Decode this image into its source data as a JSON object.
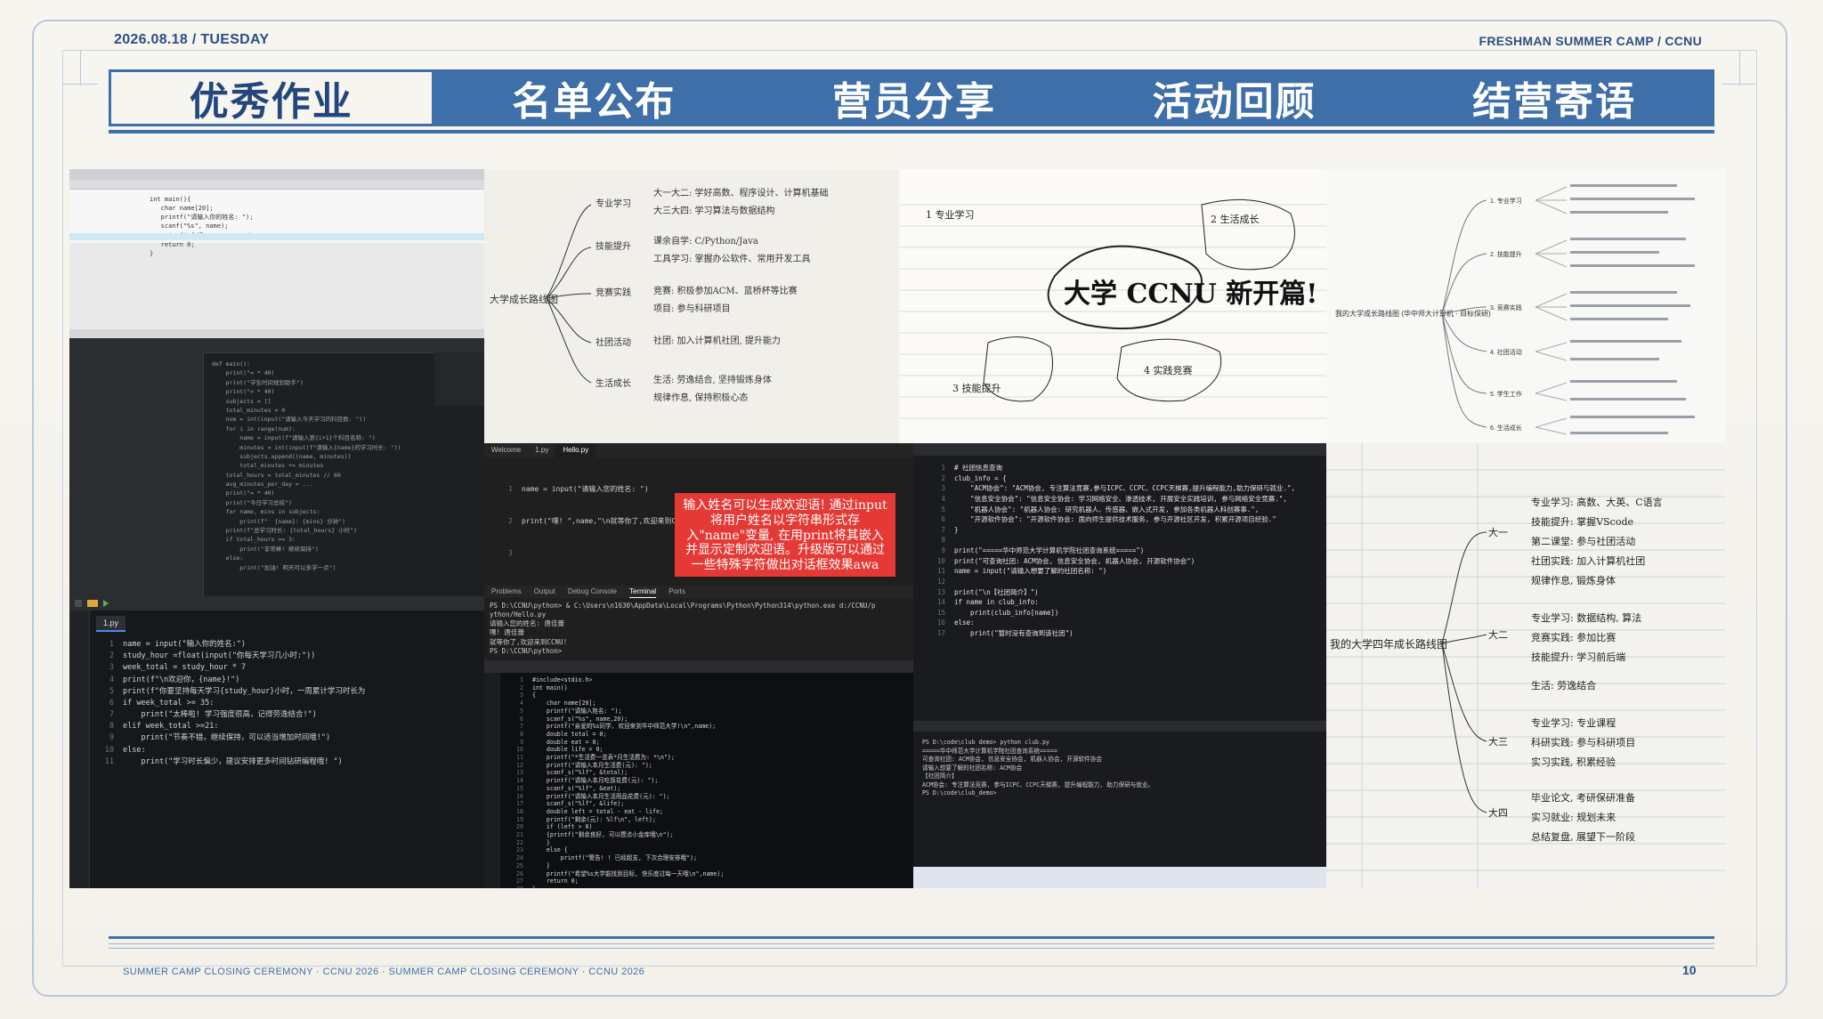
{
  "header": {
    "date": "2026.08.18 / TUESDAY",
    "org": "FRESHMAN SUMMER CAMP / CCNU"
  },
  "tabs": [
    {
      "label": "优秀作业",
      "active": true
    },
    {
      "label": "名单公布",
      "active": false
    },
    {
      "label": "营员分享",
      "active": false
    },
    {
      "label": "活动回顾",
      "active": false
    },
    {
      "label": "结营寄语",
      "active": false
    }
  ],
  "gallery": {
    "ide_python_code": [
      "name = input(\"输入你的姓名:\")",
      "study_hour =float(input(\"你每天学习几小时:\"))",
      "week_total = study_hour * 7",
      "print(f\"\\n欢迎你，{name}!\")",
      "print(f\"你要坚持每天学习{study_hour}小时，一周累计学习时长为",
      "if week_total >= 35:",
      "    print(\"太棒啦! 学习强度很高，记得劳逸结合!\")",
      "elif week_total >=21:",
      "    print(\"节奏不错，继续保持，可以适当增加时间哦!\")",
      "else:",
      "    print(\"学习时长偏少，建议安排更多时间钻研编程哦! \")"
    ],
    "ide_tab": "1.py",
    "hello_tabs": [
      "Welcome",
      "1.py",
      "Hello.py"
    ],
    "hello_code": [
      "name = input(\"请输入您的姓名: \")",
      "print(\"嘿! \",name,\"\\n就等你了,欢迎来到CCNU! \\n\")"
    ],
    "hello_note": "输入姓名可以生成欢迎语! 通过input将用户姓名以字符串形式存入\"name\"变量, 在用print将其嵌入并显示定制欢迎语。升级版可以通过一些特殊字符做出对话框效果awa",
    "terminal_tabs": [
      "Problems",
      "Output",
      "Debug Console",
      "Terminal",
      "Ports"
    ],
    "terminal_lines": [
      "PS D:\\CCNU\\python> & C:\\Users\\n1630\\AppData\\Local\\Programs\\Python\\Python314\\python.exe d:/CCNU/p",
      "ython/Hello.py",
      "请输入您的姓名: 唐佳蕾",
      "嘿! 唐佳蕾",
      "就等你了,欢迎来到CCNU!",
      "",
      "PS D:\\CCNU\\python> "
    ],
    "club_code": [
      "# 社团信息查询",
      "club_info = {",
      "    \"ACM协会\": \"ACM协会, 专注算法竞赛,参与ICPC、CCPC、CCPC天梯赛,提升编程能力,助力保研与就业.\",",
      "    \"信息安全协会\": \"信息安全协会: 学习网络安全、渗透技术, 开展安全实践培训, 参与网络安全竞赛.\",",
      "    \"机器人协会\": \"机器人协会: 研究机器人、传感器、嵌入式开发, 参加各类机器人科创赛事.\",",
      "    \"开源软件协会\": \"开源软件协会: 面向师生提供技术服务, 参与开源社区开发, 积累开源项目经验.\"",
      "}",
      "",
      "print(\"=====华中师范大学计算机学院社团查询系统=====\")",
      "print(\"可查询社团: ACM协会, 信息安全协会, 机器人协会, 开源软件协会\")",
      "name = input(\"请输入想要了解的社团名称: \")",
      "",
      "print(\"\\n【社团简介】\")",
      "if name in club_info:",
      "    print(club_info[name])",
      "else:",
      "    print(\"暂时没有查询到该社团\")"
    ],
    "club_terminal": [
      "PS D:\\code\\club demo> python club.py",
      "=====华中师范大学计算机学院社团查询系统=====",
      "可查询社团: ACM协会, 信息安全协会, 机器人协会, 开源软件协会",
      "请输入想要了解的社团名称: ACM协会",
      "",
      "【社团简介】",
      "ACM协会: 专注算法竞赛, 参与ICPC、CCPC天梯赛, 提升编程能力, 助力保研与就业。",
      "PS D:\\code\\club_demo> "
    ],
    "c_code": [
      "#include<stdio.h>",
      "int main()",
      "{",
      "    char name[20];",
      "    printf(\"请输入姓名: \");",
      "    scanf_s(\"%s\", name,20);",
      "    printf(\"亲爱的%s同学, 欢迎来到华中师范大学!\\n\",name);",
      "    double total = 0;",
      "    double eat = 0;",
      "    double life = 0;",
      "    printf(\"*生活费一览表*月生活费为: *\\n\");",
      "    printf(\"请输入本月生活费(元): \");",
      "    scanf_s(\"%lf\", &total);",
      "    printf(\"请输入本月吃饭花费(元): \");",
      "    scanf_s(\"%lf\", &eat);",
      "    printf(\"请输入本月生活用品花费(元): \");",
      "    scanf_s(\"%lf\", &life);",
      "    double left = total - eat - life;",
      "    printf(\"剩余(元): %lf\\n\", left);",
      "    if (left > 0)",
      "    {printf(\"剩余良好, 可以攒点小金库哦\\n\");",
      "    }",
      "    else {",
      "        printf(\"警告! ! 已经超支, 下次合理安排哦\");",
      "    }",
      "    printf(\"希望%s大学能找到目标, 快乐度过每一天哦\\n\",name);",
      "    return 0;",
      "}"
    ],
    "mindmap_title": "我的大学成长路线图 (华中师大计算机 · 目标保研)",
    "mindmap_nodes": [
      "1. 专业学习",
      "2. 技能提升",
      "3. 竞赛实践",
      "4. 社团活动",
      "5. 学生工作",
      "6. 生活成长"
    ],
    "ccnu_sketch": "大学 CCNU 新开篇!",
    "sketch_branches": [
      "专业学习",
      "技能提升",
      "实践竞赛",
      "生活成长"
    ],
    "handwritten_root": "我的大学四年成长路线图",
    "handwritten_branches": [
      "大一",
      "大二",
      "大三",
      "大四"
    ]
  },
  "footer": {
    "text": "SUMMER CAMP CLOSING CEREMONY · CCNU 2026 · SUMMER CAMP CLOSING CEREMONY · CCNU 2026",
    "page": "10"
  }
}
